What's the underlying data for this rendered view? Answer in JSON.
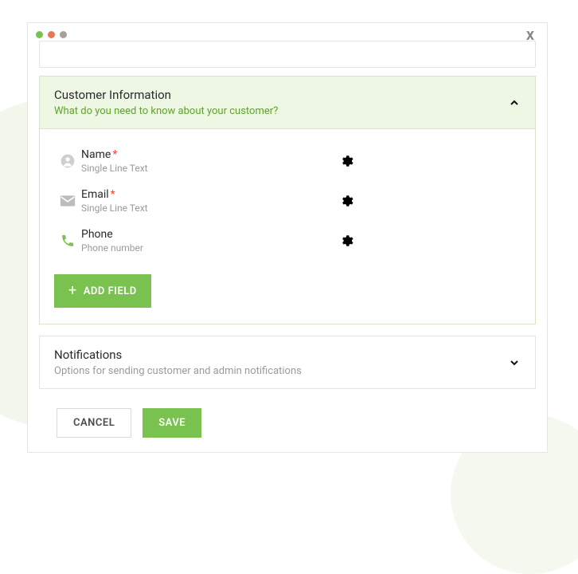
{
  "customerInfo": {
    "title": "Customer Information",
    "subtitle": "What do you need to know about your customer?",
    "fields": [
      {
        "name": "Name",
        "required": true,
        "type": "Single Line Text",
        "icon": "person"
      },
      {
        "name": "Email",
        "required": true,
        "type": "Single Line Text",
        "icon": "mail"
      },
      {
        "name": "Phone",
        "required": false,
        "type": "Phone number",
        "icon": "phone"
      }
    ],
    "addFieldLabel": "ADD FIELD"
  },
  "notifications": {
    "title": "Notifications",
    "subtitle": "Options for sending customer and admin notifications"
  },
  "actions": {
    "cancel": "CANCEL",
    "save": "SAVE"
  },
  "close": "x"
}
